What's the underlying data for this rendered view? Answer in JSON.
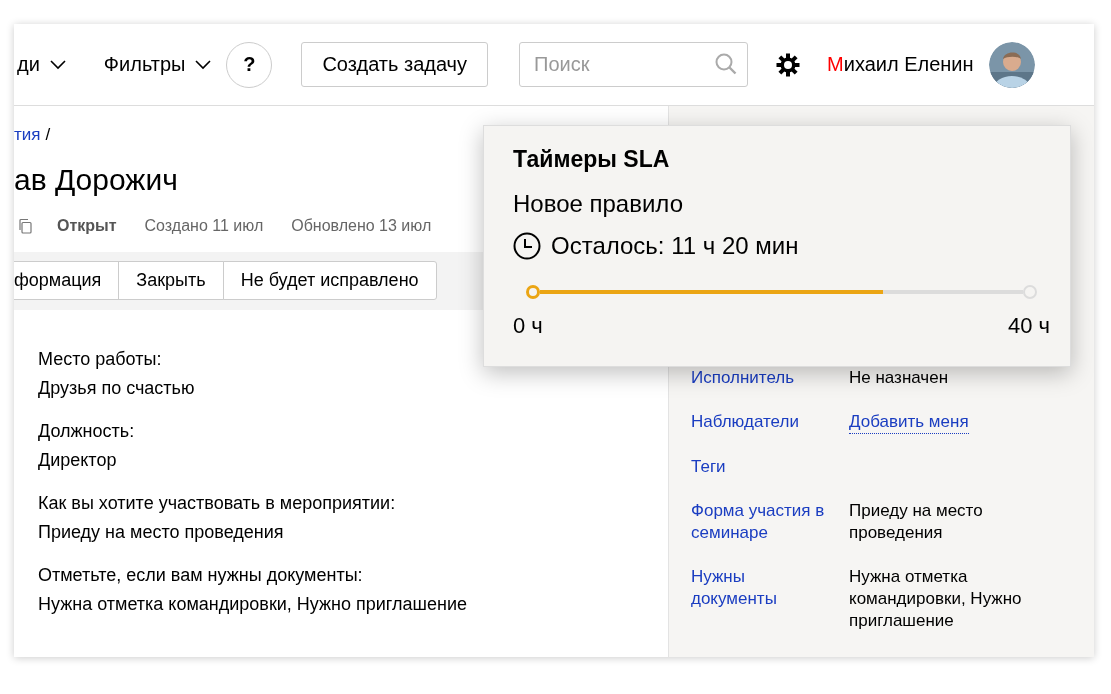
{
  "header": {
    "nav": [
      {
        "label": "ди"
      },
      {
        "label": "Фильтры"
      }
    ],
    "help": "?",
    "create_button": "Создать задачу",
    "search": {
      "placeholder": "Поиск"
    },
    "user": {
      "name": "Михаил Еленин"
    }
  },
  "issue": {
    "breadcrumb": {
      "link": "тия",
      "separator": "/"
    },
    "title": "ав Дорожич",
    "status": "Открыт",
    "created": "Создано 11 июл",
    "updated": "Обновлено 13 июл",
    "actions": [
      "формация",
      "Закрыть",
      "Не будет исправлено"
    ],
    "fields": [
      {
        "label": "Место работы:",
        "value": "Друзья по счастью"
      },
      {
        "label": "Должность:",
        "value": "Директор"
      },
      {
        "label": "Как вы хотите участвовать в мероприятии:",
        "value": "Приеду на место проведения"
      },
      {
        "label": "Отметьте, если вам нужны документы:",
        "value": "Нужна отметка командировки, Нужно приглашение"
      }
    ]
  },
  "sidebar": {
    "rows": [
      {
        "label": "Исполнитель",
        "value": "Не назначен",
        "kind": "text"
      },
      {
        "label": "Наблюдатели",
        "value": "Добавить меня",
        "kind": "link"
      },
      {
        "label": "Теги",
        "kind": "empty"
      },
      {
        "label": "Форма участия в семинаре",
        "value": "Приеду на место проведения",
        "kind": "text"
      },
      {
        "label": "Нужны документы",
        "value": "Нужна отметка командировки, Нужно приглашение",
        "kind": "text"
      }
    ]
  },
  "sla_popup": {
    "title": "Таймеры SLA",
    "rule": "Новое правило",
    "remaining": "Осталось: 11 ч 20 мин",
    "level": 0.71,
    "min_label": "0 ч",
    "max_label": "40 ч"
  }
}
